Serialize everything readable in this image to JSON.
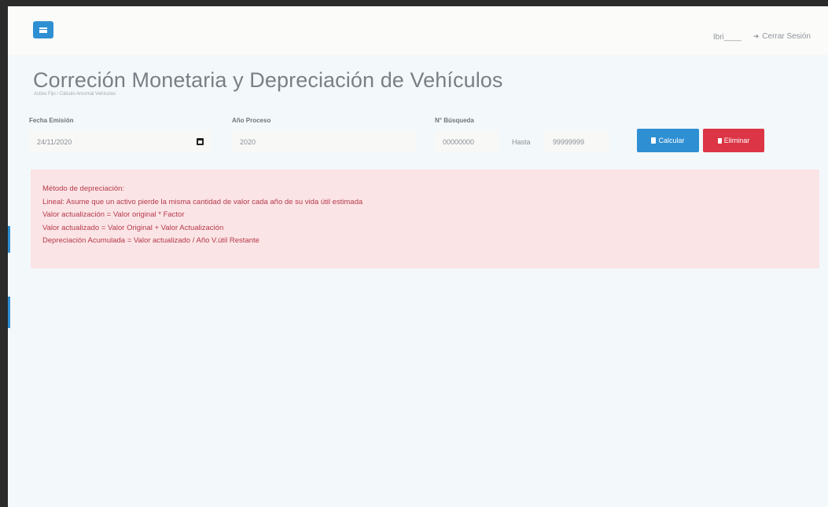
{
  "header": {
    "menu_icon": "hamburger-icon",
    "user_text": "Ibri____",
    "logout_label": "Cerrar Sesión",
    "logout_icon": "sign-out-icon"
  },
  "page": {
    "title": "Correción Monetaria y Depreciación de Vehículos",
    "breadcrumb": "Activo Fijo / Cálculo Anormal Vehículos"
  },
  "form": {
    "fecha_emision": {
      "label": "Fecha Emisión",
      "value": "24/11/2020"
    },
    "anio_proceso": {
      "label": "Año Proceso",
      "value": "2020"
    },
    "n_busqueda": {
      "label": "N° Búsqueda",
      "from_value": "00000000",
      "to_label": "Hasta",
      "to_value": "99999999"
    },
    "calcular_label": "Calcular",
    "eliminar_label": "Eliminar"
  },
  "alert": {
    "lines": [
      "Método de depreciación:",
      "Lineal: Asume que un activo pierde la misma cantidad de valor cada año de su vida útil estimada",
      "Valor actualización = Valor original * Factor",
      "Valor actualizado = Valor Original + Valor Actualización",
      "Depreciación Acumulada = Valor actualizado / Año V.útil Restante"
    ]
  },
  "colors": {
    "primary": "#2f8fd3",
    "danger": "#dc3545",
    "alert_bg": "#fbe4e6",
    "alert_text": "#b53a4a"
  }
}
